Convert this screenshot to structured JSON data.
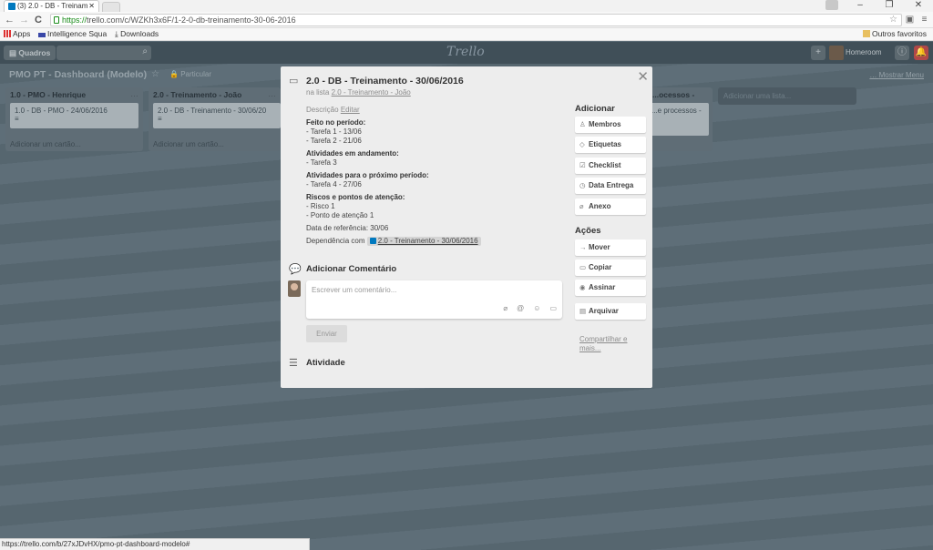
{
  "browser": {
    "tab_title": "(3) 2.0 - DB - Treinam",
    "url_scheme": "https://",
    "url_rest": "trello.com/c/WZKh3x6F/1-2-0-db-treinamento-30-06-2016",
    "bookmarks": {
      "apps": "Apps",
      "intelligence": "Intelligence Squa",
      "downloads": "Downloads",
      "other": "Outros favoritos"
    },
    "status_url": "https://trello.com/b/27xJDvHX/pmo-pt-dashboard-modelo#"
  },
  "header": {
    "boards": "Quadros",
    "logo": "Trello",
    "user": "Homeroom"
  },
  "board": {
    "title": "PMO PT - Dashboard (Modelo)",
    "privacy": "Particular",
    "show_menu": "Mostrar Menu",
    "add_list": "Adicionar uma lista...",
    "lists": [
      {
        "name": "1.0 - PMO - Henrique",
        "card": "1.0 - DB - PMO - 24/06/2016",
        "add": "Adicionar um cartão..."
      },
      {
        "name": "2.0 - Treinamento - João",
        "card": "2.0 - DB - Treinamento - 30/06/20",
        "add": "Adicionar um cartão..."
      },
      {
        "name": "...ocessos -",
        "card": "...e processos -"
      }
    ]
  },
  "card": {
    "title": "2.0 - DB - Treinamento - 30/06/2016",
    "in_list_prefix": "na lista",
    "in_list": "2.0 - Treinamento - João",
    "desc_label": "Descrição",
    "edit": "Editar",
    "sections": [
      {
        "heading": "Feito no período:",
        "lines": [
          "- Tarefa 1 - 13/06",
          "- Tarefa 2 - 21/06"
        ]
      },
      {
        "heading": "Atividades em andamento:",
        "lines": [
          "- Tarefa 3"
        ]
      },
      {
        "heading": "Atividades para o próximo período:",
        "lines": [
          "- Tarefa 4 - 27/06"
        ]
      },
      {
        "heading": "Riscos e pontos de atenção:",
        "lines": [
          "- Risco 1",
          "- Ponto de atenção 1"
        ]
      }
    ],
    "ref_date": "Data de referência: 30/06",
    "dependency_label": "Dependência com",
    "dependency": "2.0 - Treinamento - 30/06/2016",
    "add_comment": "Adicionar Comentário",
    "comment_placeholder": "Escrever um comentário...",
    "send": "Enviar",
    "activity": "Atividade"
  },
  "sidebar": {
    "add_title": "Adicionar",
    "add_buttons": [
      "Membros",
      "Etiquetas",
      "Checklist",
      "Data Entrega",
      "Anexo"
    ],
    "actions_title": "Ações",
    "action_buttons": [
      "Mover",
      "Copiar",
      "Assinar",
      "Arquivar"
    ],
    "share": "Compartilhar e mais..."
  }
}
